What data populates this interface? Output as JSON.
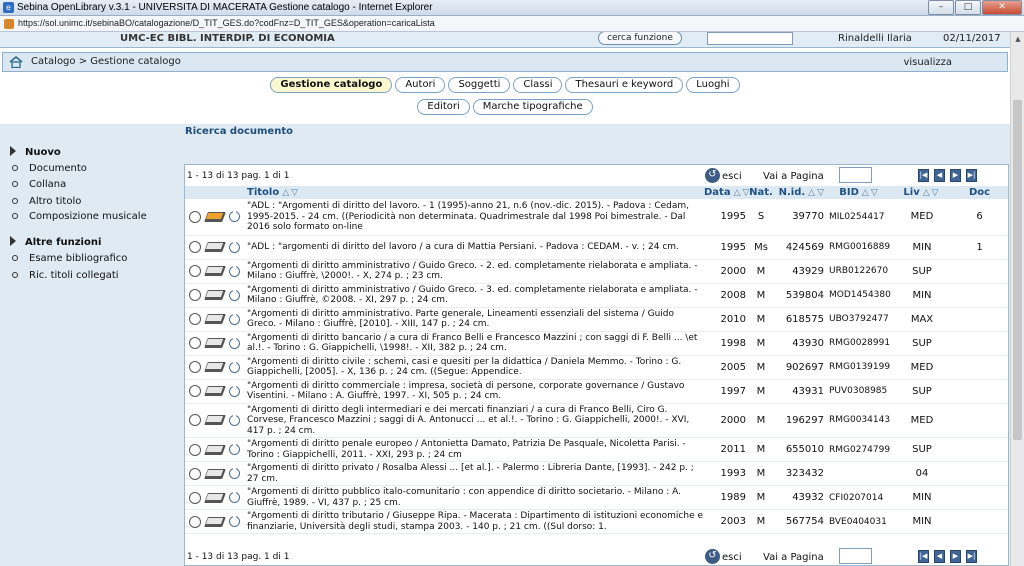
{
  "window": {
    "title": "Sebina OpenLibrary v.3.1 - UNIVERSITA DI MACERATA Gestione catalogo - Internet Explorer",
    "url": "https://sol.unimc.it/sebinaBO/catalogazione/D_TIT_GES.do?codFnz=D_TIT_GES&operation=caricaLista",
    "buttons": [
      "minimize",
      "maximize",
      "close"
    ]
  },
  "infobar": {
    "library": "UMC-EC BIBL. INTERDIP. DI ECONOMIA",
    "find_button": "cerca funzione",
    "user": "Rinaldelli Ilaria",
    "date": "02/11/2017"
  },
  "breadcrumb": {
    "text": "Catalogo > Gestione catalogo",
    "view_link": "visualizza"
  },
  "tabs_row1": [
    "Gestione catalogo",
    "Autori",
    "Soggetti",
    "Classi",
    "Thesauri e keyword",
    "Luoghi"
  ],
  "tabs_row2": [
    "Editori",
    "Marche tipografiche"
  ],
  "active_tab": "Gestione catalogo",
  "sidebar": {
    "new_heading": "Nuovo",
    "new_items": [
      "Documento",
      "Collana",
      "Altro titolo",
      "Composizione musicale"
    ],
    "other_heading": "Altre funzioni",
    "other_items": [
      "Esame bibliografico",
      "Ric. titoli collegati"
    ]
  },
  "main": {
    "section_title": "Ricerca documento",
    "count_text": "1 - 13 di 13  pag. 1 di 1",
    "exit_label": "esci",
    "goto_label": "Vai a Pagina",
    "columns": {
      "title": "Titolo",
      "date": "Data",
      "nature": "Nat.",
      "nid": "N.id.",
      "bid": "BID",
      "level": "Liv",
      "doc": "Doc"
    },
    "rows": [
      {
        "title": "\"ADL : \"Argomenti di diritto del lavoro. - 1 (1995)-anno 21, n.6 (nov.-dic. 2015). - Padova : Cedam, 1995-2015. - 24 cm. ((Periodicità non determinata. Quadrimestrale dal 1998 Poi bimestrale. - Dal 2016 solo formato on-line",
        "date": "1995",
        "nature": "S",
        "nid": "39770",
        "bid": "MIL0254417",
        "level": "MED",
        "doc": "6"
      },
      {
        "title": "\"ADL : \"argomenti di diritto del lavoro / a cura di Mattia Persiani. - Padova : CEDAM. - v. ; 24 cm.",
        "date": "1995",
        "nature": "Ms",
        "nid": "424569",
        "bid": "RMG0016889",
        "level": "MIN",
        "doc": "1"
      },
      {
        "title": "\"Argomenti di diritto amministrativo / Guido Greco. - 2. ed. completamente rielaborata e ampliata. - Milano : Giuffrè, \\2000!. - X, 274 p. ; 23 cm.",
        "date": "2000",
        "nature": "M",
        "nid": "43929",
        "bid": "URB0122670",
        "level": "SUP",
        "doc": ""
      },
      {
        "title": "\"Argomenti di diritto amministrativo / Guido Greco. - 3. ed. completamente rielaborata e ampliata. - Milano : Giuffrè, ©2008. - XI, 297 p. ; 24 cm.",
        "date": "2008",
        "nature": "M",
        "nid": "539804",
        "bid": "MOD1454380",
        "level": "MIN",
        "doc": ""
      },
      {
        "title": "\"Argomenti di diritto amministrativo. Parte generale, Lineamenti essenziali del sistema / Guido Greco. - Milano : Giuffrè, [2010]. - XIII, 147 p. ; 24 cm.",
        "date": "2010",
        "nature": "M",
        "nid": "618575",
        "bid": "UBO3792477",
        "level": "MAX",
        "doc": ""
      },
      {
        "title": "\"Argomenti di diritto bancario / a cura di Franco Belli e Francesco Mazzini ; con saggi di F. Belli ... \\et al.!. - Torino : G. Giappichelli, \\1998!. - XII, 382 p. ; 24 cm.",
        "date": "1998",
        "nature": "M",
        "nid": "43930",
        "bid": "RMG0028991",
        "level": "SUP",
        "doc": ""
      },
      {
        "title": "\"Argomenti di diritto civile : schemi, casi e quesiti per la didattica / Daniela Memmo. - Torino : G. Giappichelli, [2005]. - X, 136 p. ; 24 cm. ((Segue: Appendice.",
        "date": "2005",
        "nature": "M",
        "nid": "902697",
        "bid": "RMG0139199",
        "level": "MED",
        "doc": ""
      },
      {
        "title": "\"Argomenti di diritto commerciale : impresa, società di persone, corporate governance / Gustavo Visentini. - Milano : A. Giuffrè, 1997. - XI, 505 p. ; 24 cm.",
        "date": "1997",
        "nature": "M",
        "nid": "43931",
        "bid": "PUV0308985",
        "level": "SUP",
        "doc": ""
      },
      {
        "title": "\"Argomenti di diritto degli intermediari e dei mercati finanziari / a cura di Franco Belli, Ciro G. Corvese, Francesco Mazzini ; saggi di A. Antonucci ... et al.!. - Torino : G. Giappichelli, 2000!. - XVI, 417 p. ; 24 cm.",
        "date": "2000",
        "nature": "M",
        "nid": "196297",
        "bid": "RMG0034143",
        "level": "MED",
        "doc": ""
      },
      {
        "title": "\"Argomenti di diritto penale europeo / Antonietta Damato, Patrizia De Pasquale, Nicoletta Parisi. - Torino : Giappichelli, 2011. - XXI, 293 p. ; 24 cm",
        "date": "2011",
        "nature": "M",
        "nid": "655010",
        "bid": "RMG0274799",
        "level": "SUP",
        "doc": ""
      },
      {
        "title": "\"Argomenti di diritto privato / Rosalba Alessi ... [et al.]. - Palermo : Libreria Dante, [1993]. - 242 p. ; 27 cm.",
        "date": "1993",
        "nature": "M",
        "nid": "323432",
        "bid": "",
        "level": "04",
        "doc": ""
      },
      {
        "title": "\"Argomenti di diritto pubblico italo-comunitario : con appendice di diritto societario. - Milano : A. Giuffrè, 1989. - VI, 437 p. ; 25 cm.",
        "date": "1989",
        "nature": "M",
        "nid": "43932",
        "bid": "CFI0207014",
        "level": "MIN",
        "doc": ""
      },
      {
        "title": "\"Argomenti di diritto tributario / Giuseppe Ripa. - Macerata : Dipartimento di istituzioni economiche e finanziarie, Università degli studi, stampa 2003. - 140 p. ; 21 cm. ((Sul dorso: 1.",
        "date": "2003",
        "nature": "M",
        "nid": "567754",
        "bid": "BVE0404031",
        "level": "MIN",
        "doc": ""
      }
    ]
  }
}
